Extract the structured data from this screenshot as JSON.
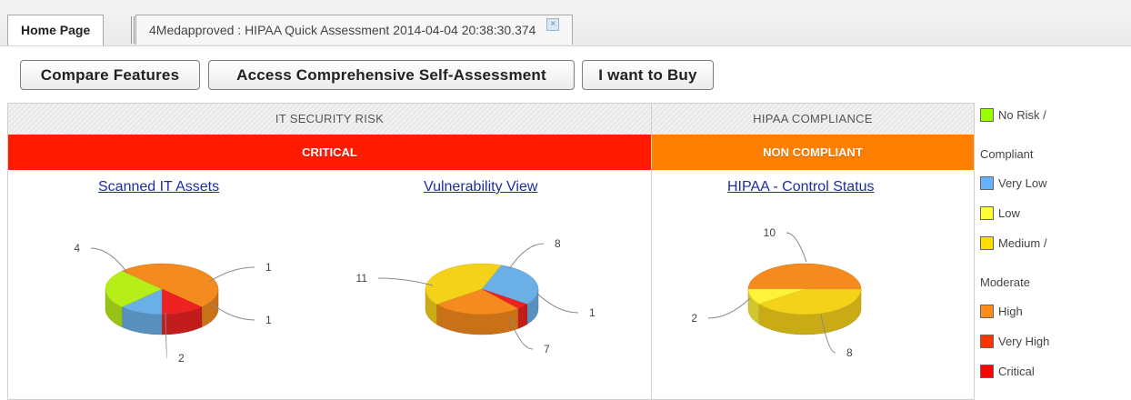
{
  "tabs": {
    "home": "Home Page",
    "assessment": "4Medapproved : HIPAA Quick Assessment 2014-04-04 20:38:30.374",
    "close_glyph": "×"
  },
  "toolbar": {
    "compare": "Compare Features",
    "self_assessment": "Access Comprehensive Self-Assessment",
    "buy": "I want to Buy"
  },
  "it_security": {
    "header": "IT SECURITY RISK",
    "status": "CRITICAL",
    "status_color": "#ff1a00",
    "scanned_link": "Scanned IT Assets",
    "vulnerability_link": "Vulnerability View"
  },
  "hipaa": {
    "header": "HIPAA COMPLIANCE",
    "status": "NON COMPLIANT",
    "status_color": "#ff7f00",
    "control_link": "HIPAA - Control Status"
  },
  "legend": {
    "items": [
      {
        "label": "No Risk /",
        "color": "#99ff00"
      },
      {
        "label": "Compliant",
        "color": null
      },
      {
        "label": "Very Low",
        "color": "#66b2ff"
      },
      {
        "label": "Low",
        "color": "#ffff33"
      },
      {
        "label": "Medium /",
        "color": "#ffdd00"
      },
      {
        "label": "Moderate",
        "color": null
      },
      {
        "label": "High",
        "color": "#ff8c1a"
      },
      {
        "label": "Very High",
        "color": "#ff3300"
      },
      {
        "label": "Critical",
        "color": "#ff0000"
      }
    ]
  },
  "chart_data": [
    {
      "type": "pie",
      "title": "Scanned IT Assets",
      "slices": [
        {
          "category": "High",
          "value": 4,
          "color": "#f58a1f"
        },
        {
          "category": "Critical",
          "value": 1,
          "color": "#ee2222"
        },
        {
          "category": "Very Low",
          "value": 1,
          "color": "#6ab0e6"
        },
        {
          "category": "No Risk / Compliant",
          "value": 2,
          "color": "#b7ee1a"
        }
      ]
    },
    {
      "type": "pie",
      "title": "Vulnerability View",
      "slices": [
        {
          "category": "Very Low",
          "value": 8,
          "color": "#6ab0e6"
        },
        {
          "category": "Critical",
          "value": 1,
          "color": "#ee2222"
        },
        {
          "category": "High",
          "value": 7,
          "color": "#f58a1f"
        },
        {
          "category": "Medium / Moderate",
          "value": 11,
          "color": "#f5d21a"
        }
      ]
    },
    {
      "type": "pie",
      "title": "HIPAA - Control Status",
      "slices": [
        {
          "category": "High",
          "value": 10,
          "color": "#f58a1f"
        },
        {
          "category": "Medium / Moderate",
          "value": 8,
          "color": "#f5d21a"
        },
        {
          "category": "Low",
          "value": 2,
          "color": "#fff23a"
        }
      ]
    }
  ]
}
